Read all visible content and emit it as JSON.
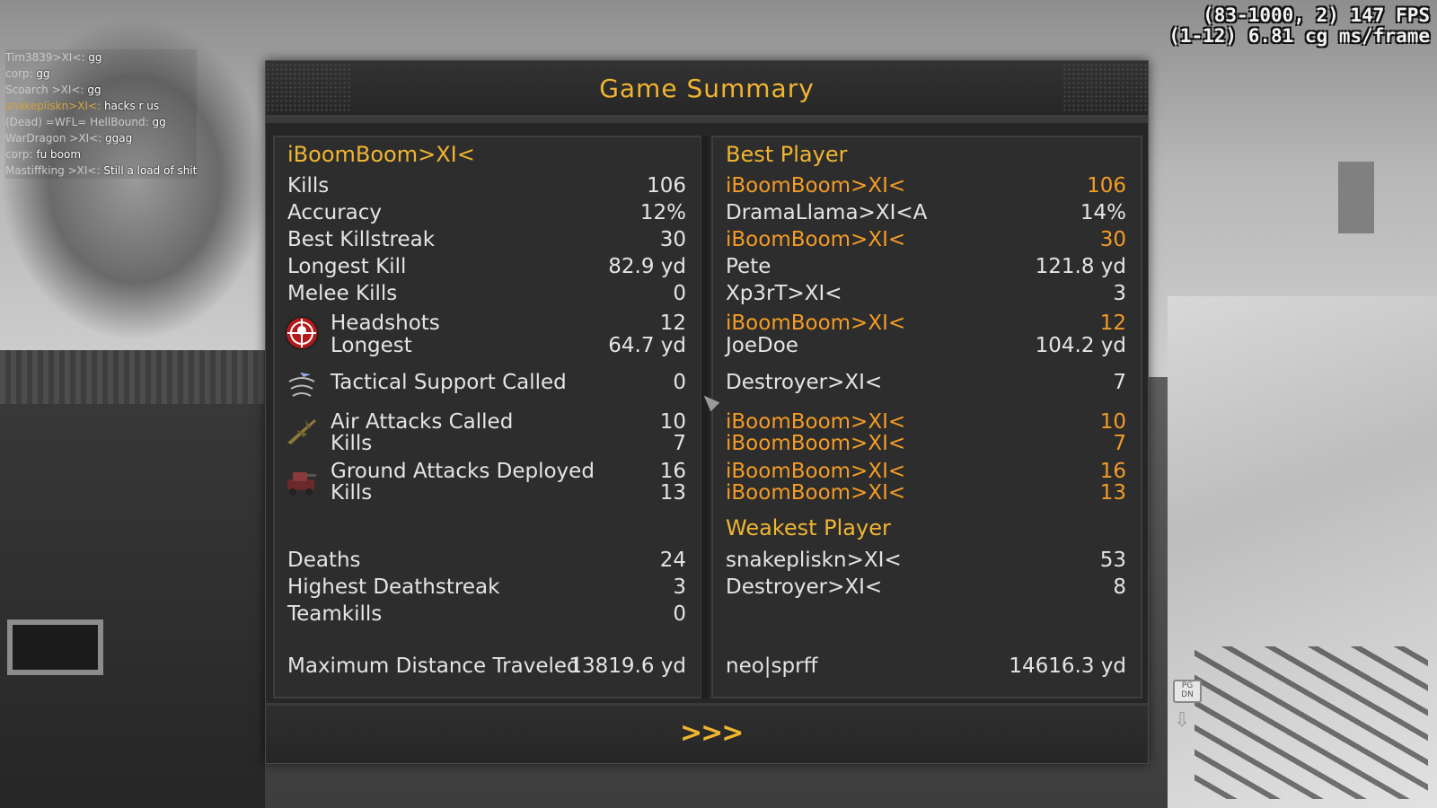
{
  "hud": {
    "fps_line1": "(83-1000, 2) 147 FPS",
    "fps_line2": "(1-12) 6.81 cg ms/frame"
  },
  "chat": [
    {
      "name": "Tim3839>XI<:",
      "msg": "gg",
      "highlight": false
    },
    {
      "name": "corp:",
      "msg": "gg",
      "highlight": false
    },
    {
      "name": "Scoarch >XI<:",
      "msg": "gg",
      "highlight": false
    },
    {
      "name": "snakepliskn>XI<:",
      "msg": "hacks r us",
      "highlight": true
    },
    {
      "name": "(Dead) =WFL= HellBound:",
      "msg": "gg",
      "highlight": false
    },
    {
      "name": "WarDragon >XI<:",
      "msg": "ggag",
      "highlight": false
    },
    {
      "name": "corp:",
      "msg": "fu boom",
      "highlight": false
    },
    {
      "name": "Mastiffking >XI<:",
      "msg": "Still a load of shit",
      "highlight": false
    }
  ],
  "summary": {
    "title": "Game Summary",
    "player_name": "iBoomBoom>XI<",
    "best_player_heading": "Best Player",
    "weakest_player_heading": "Weakest Player",
    "stats": [
      {
        "label": "Kills",
        "value": "106",
        "best_name": "iBoomBoom>XI<",
        "best_value": "106",
        "self_best": true
      },
      {
        "label": "Accuracy",
        "value": "12%",
        "best_name": "DramaLlama>XI<A",
        "best_value": "14%",
        "self_best": false
      },
      {
        "label": "Best Killstreak",
        "value": "30",
        "best_name": "iBoomBoom>XI<",
        "best_value": "30",
        "self_best": true
      },
      {
        "label": "Longest Kill",
        "value": "82.9 yd",
        "best_name": "Pete",
        "best_value": "121.8 yd",
        "self_best": false
      },
      {
        "label": "Melee Kills",
        "value": "0",
        "best_name": "Xp3rT>XI<",
        "best_value": "3",
        "self_best": false
      },
      {
        "label": "Headshots",
        "value": "12",
        "best_name": "iBoomBoom>XI<",
        "best_value": "12",
        "self_best": true
      },
      {
        "label": "Longest",
        "value": "64.7 yd",
        "best_name": "JoeDoe",
        "best_value": "104.2 yd",
        "self_best": false
      },
      {
        "label": "Tactical Support Called",
        "value": "0",
        "best_name": "Destroyer>XI<",
        "best_value": "7",
        "self_best": false
      },
      {
        "label": "Air Attacks Called",
        "value": "10",
        "best_name": "iBoomBoom>XI<",
        "best_value": "10",
        "self_best": true
      },
      {
        "label": "Kills",
        "value": "7",
        "best_name": "iBoomBoom>XI<",
        "best_value": "7",
        "self_best": true
      },
      {
        "label": "Ground Attacks Deployed",
        "value": "16",
        "best_name": "iBoomBoom>XI<",
        "best_value": "16",
        "self_best": true
      },
      {
        "label": "Kills",
        "value": "13",
        "best_name": "iBoomBoom>XI<",
        "best_value": "13",
        "self_best": true
      }
    ],
    "weak_stats": [
      {
        "label": "Deaths",
        "value": "24",
        "worst_name": "snakepliskn>XI<",
        "worst_value": "53"
      },
      {
        "label": "Highest Deathstreak",
        "value": "3",
        "worst_name": "Destroyer>XI<",
        "worst_value": "8"
      },
      {
        "label": "Teamkills",
        "value": "0",
        "worst_name": "",
        "worst_value": ""
      }
    ],
    "distance": {
      "label": "Maximum Distance Traveled",
      "value": "13819.6 yd",
      "best_name": "neo|sprff",
      "best_value": "14616.3 yd"
    },
    "continue_label": ">>>"
  },
  "background": {
    "pgdn_label": "PG DN"
  },
  "colors": {
    "accent_gold": "#f0b531",
    "highlight_orange": "#f39c26",
    "panel_bg": "#2d2d2d"
  }
}
